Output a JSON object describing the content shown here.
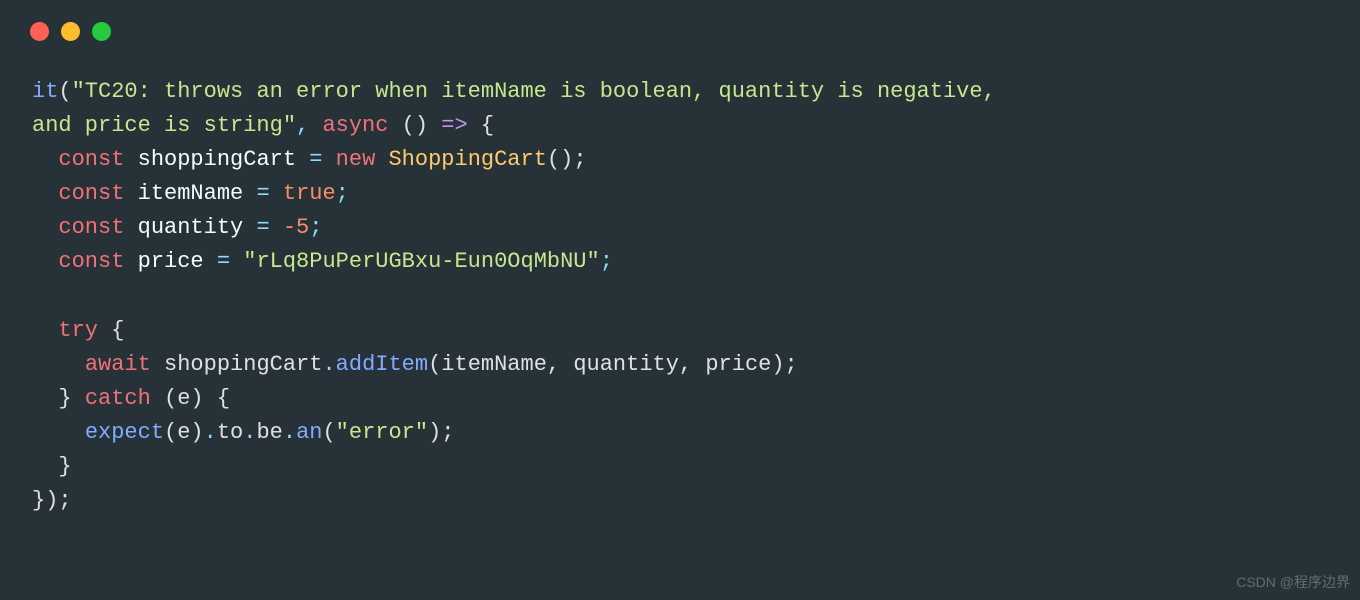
{
  "colors": {
    "background": "#263238",
    "red_dot": "#ff5f56",
    "yellow_dot": "#ffbd2e",
    "green_dot": "#27c93f",
    "string": "#c3e88d",
    "keyword": "#c792ea",
    "kw_red": "#f07178",
    "function": "#82aaff",
    "class": "#ffcb6b",
    "number": "#f78c6c",
    "punct": "#89ddff",
    "default": "#e0e0e0"
  },
  "code": {
    "fn_it": "it",
    "test_desc_1": "\"TC20: throws an error when itemName is boolean, quantity is negative, ",
    "test_desc_2": "and price is string\"",
    "kw_async": "async",
    "arrow_open": " () ",
    "arrow": "=>",
    "brace_open": " {",
    "kw_const": "const",
    "var_cart": "shoppingCart",
    "eq": " = ",
    "kw_new": "new",
    "class_cart": "ShoppingCart",
    "call_empty": "();",
    "var_item": "itemName",
    "val_true": "true",
    "semi": ";",
    "var_qty": "quantity",
    "val_neg5": "-5",
    "var_price": "price",
    "val_price_str": "\"rLq8PuPerUGBxu-Eun0OqMbNU\"",
    "kw_try": "try",
    "kw_await": "await",
    "method_add": "addItem",
    "args_add": "(itemName, quantity, price);",
    "kw_catch": "catch",
    "catch_param": "(e) {",
    "fn_expect": "expect",
    "expect_arg": "(e).",
    "prop_to": "to",
    "prop_be": "be",
    "method_an": "an",
    "an_arg": "(\"error\");",
    "str_error": "\"error\"",
    "brace_close": "}",
    "close_stmt": "});",
    "dot": "."
  },
  "watermark": "CSDN @程序边界"
}
